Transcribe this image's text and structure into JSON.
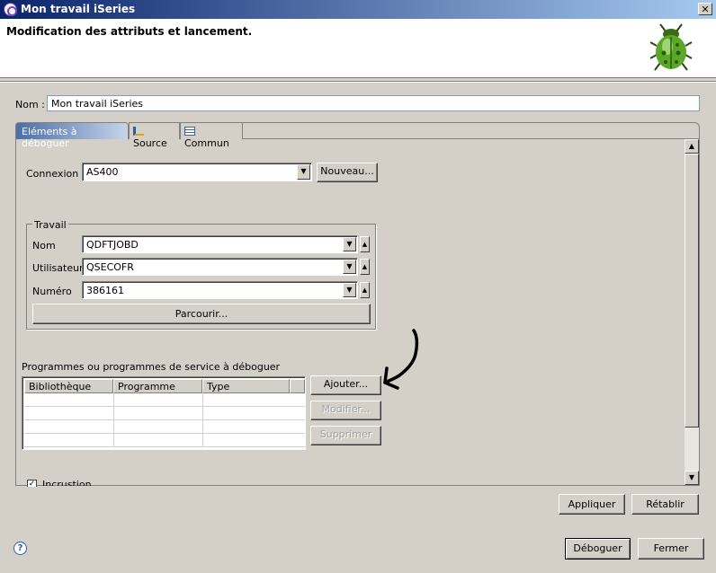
{
  "window": {
    "title": "Mon travail iSeries",
    "close_label": "✕"
  },
  "header": {
    "title": "Modification des attributs et lancement."
  },
  "name_field": {
    "label": "Nom :",
    "value": "Mon travail iSeries"
  },
  "tabs": [
    {
      "label": "Eléments à déboguer",
      "active": true
    },
    {
      "label": "Source"
    },
    {
      "label": "Commun"
    }
  ],
  "connection": {
    "label": "Connexion :",
    "value": "AS400",
    "new_button": "Nouveau..."
  },
  "job": {
    "group_label": "Travail",
    "name_label": "Nom",
    "name_value": "QDFTJOBD",
    "user_label": "Utilisateur",
    "user_value": "QSECOFR",
    "number_label": "Numéro",
    "number_value": "386161",
    "browse_button": "Parcourir..."
  },
  "programs": {
    "section_label": "Programmes ou programmes de service à déboguer",
    "columns": [
      "Bibliothèque",
      "Programme",
      "Type"
    ],
    "add_button": "Ajouter...",
    "modify_button": "Modifier...",
    "delete_button": "Supprimer"
  },
  "option": {
    "label": "Incrustion"
  },
  "actions": {
    "apply": "Appliquer",
    "revert": "Rétablir",
    "debug": "Déboguer",
    "close": "Fermer"
  },
  "icons": {
    "bug": "ladybug-icon",
    "help": "help-icon"
  }
}
